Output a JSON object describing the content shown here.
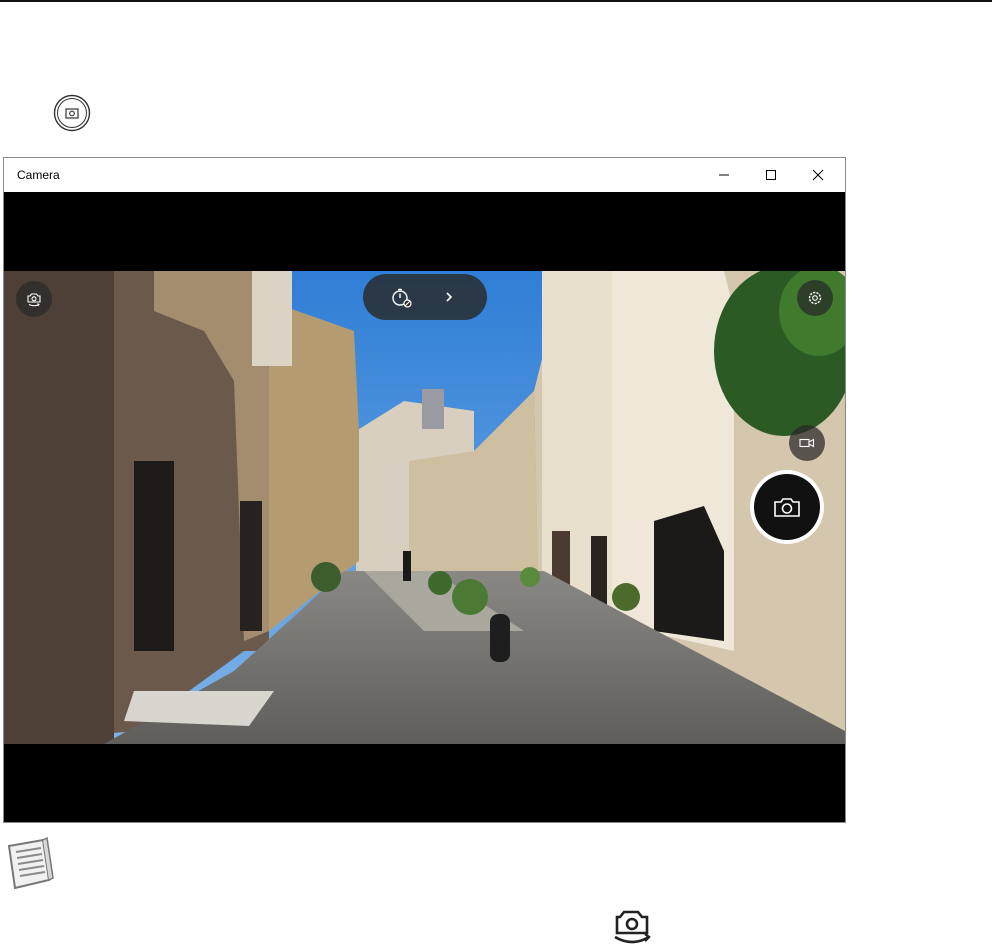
{
  "window": {
    "title": "Camera"
  },
  "titlebar_buttons": [
    "minimize-icon",
    "maximize-icon",
    "close-icon"
  ],
  "camera_controls": {
    "switch_camera": "camera-switch-icon",
    "timer": "timer-off-icon",
    "expand": "chevron-right-icon",
    "settings": "gear-icon",
    "video_mode": "video-camera-icon",
    "take_photo": "camera-icon"
  },
  "doc_icons": [
    "shutter-icon",
    "note-icon",
    "camera-switch-icon"
  ],
  "colors": {
    "sky": "#3c88d8",
    "viewfinder_bg": "#000000",
    "control_bg": "#282828"
  }
}
